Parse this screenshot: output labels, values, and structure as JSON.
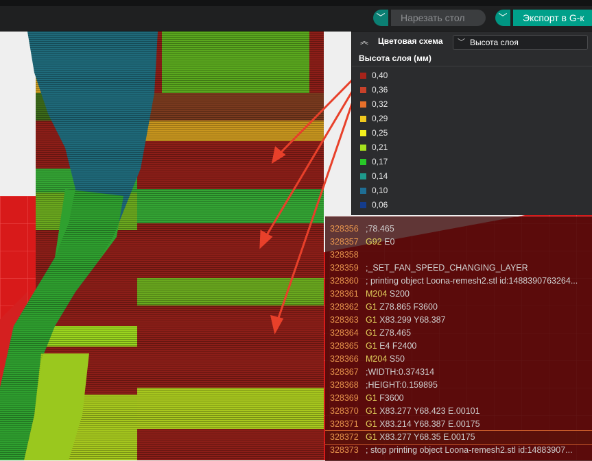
{
  "toolbar": {
    "slice_label": "Нарезать стол",
    "export_label": "Экспорт в G-к",
    "dropdown_glyph": "﹀"
  },
  "legend": {
    "collapse_glyph": "︽",
    "scheme_label": "Цветовая схема",
    "scheme_value": "Высота слоя",
    "scheme_chevron": "﹀",
    "title": "Высота слоя (мм)",
    "items": [
      {
        "value": "0,40",
        "color": "#a8231a"
      },
      {
        "value": "0,36",
        "color": "#c8412a"
      },
      {
        "value": "0,32",
        "color": "#e8702a"
      },
      {
        "value": "0,29",
        "color": "#f0c81e"
      },
      {
        "value": "0,25",
        "color": "#f4f01e"
      },
      {
        "value": "0,21",
        "color": "#a6e21e"
      },
      {
        "value": "0,17",
        "color": "#28c828"
      },
      {
        "value": "0,14",
        "color": "#1e9a8c"
      },
      {
        "value": "0,10",
        "color": "#1e6e94"
      },
      {
        "value": "0,06",
        "color": "#143c8c"
      }
    ]
  },
  "gcode": {
    "lines": [
      {
        "num": "328356",
        "op": "",
        "args": ";78.465"
      },
      {
        "num": "328357",
        "op": "G92",
        "args": " E0"
      },
      {
        "num": "328358",
        "op": "",
        "args": ""
      },
      {
        "num": "328359",
        "op": "",
        "args": ";_SET_FAN_SPEED_CHANGING_LAYER"
      },
      {
        "num": "328360",
        "op": "",
        "args": "; printing object Loona-remesh2.stl id:1488390763264..."
      },
      {
        "num": "328361",
        "op": "M204",
        "args": " S200"
      },
      {
        "num": "328362",
        "op": "G1",
        "args": " Z78.865 F3600"
      },
      {
        "num": "328363",
        "op": "G1",
        "args": " X83.299 Y68.387"
      },
      {
        "num": "328364",
        "op": "G1",
        "args": " Z78.465"
      },
      {
        "num": "328365",
        "op": "G1",
        "args": " E4 F2400"
      },
      {
        "num": "328366",
        "op": "M204",
        "args": " S50"
      },
      {
        "num": "328367",
        "op": "",
        "args": ";WIDTH:0.374314"
      },
      {
        "num": "328368",
        "op": "",
        "args": ";HEIGHT:0.159895"
      },
      {
        "num": "328369",
        "op": "G1",
        "args": " F3600"
      },
      {
        "num": "328370",
        "op": "G1",
        "args": " X83.277 Y68.423 E.00101"
      },
      {
        "num": "328371",
        "op": "G1",
        "args": " X83.214 Y68.387 E.00175"
      },
      {
        "num": "328372",
        "op": "G1",
        "args": " X83.277 Y68.35 E.00175"
      },
      {
        "num": "328373",
        "op": "",
        "args": "; stop printing object Loona-remesh2.stl id:14883907..."
      }
    ],
    "active_line": "328372"
  }
}
